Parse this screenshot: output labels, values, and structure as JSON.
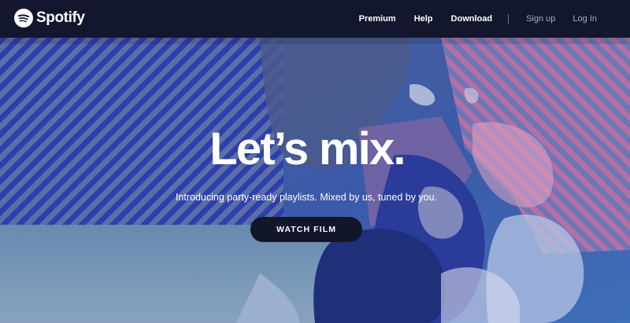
{
  "brand": {
    "name": "Spotify",
    "logo_icon": "spotify-logo-icon"
  },
  "nav": {
    "premium": "Premium",
    "help": "Help",
    "download": "Download",
    "signup": "Sign up",
    "login": "Log In"
  },
  "hero": {
    "headline": "Let’s mix.",
    "subline": "Introducing party-ready playlists. Mixed by us, tuned by you.",
    "cta": "WATCH FILM"
  },
  "colors": {
    "navbar": "#12172d",
    "hero_base": "#3d4f86",
    "stripe_blue": "#2d3fb0",
    "stripe_pink": "#b66fa5",
    "cta_bg": "#111629",
    "text": "#ffffff",
    "muted_text": "#a8adbc"
  }
}
